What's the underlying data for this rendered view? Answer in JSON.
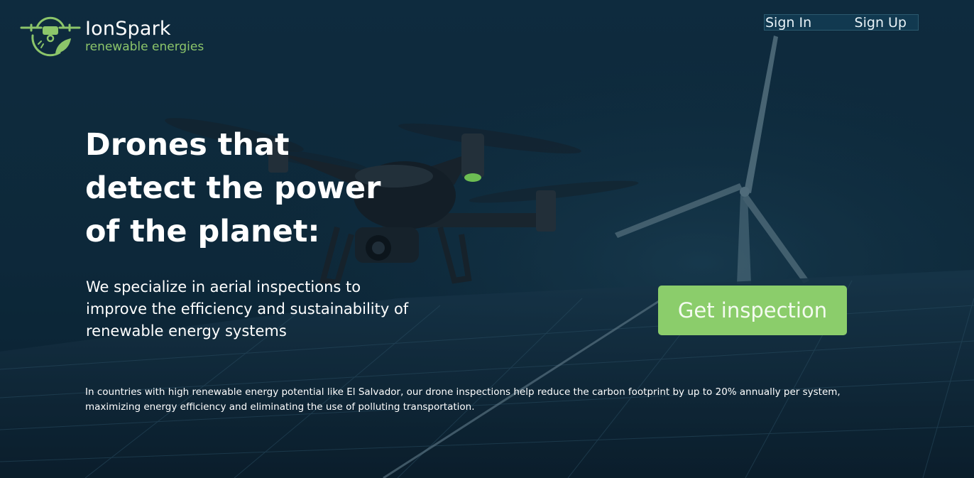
{
  "brand": {
    "name": "IonSpark",
    "tagline": "renewable energies",
    "accent_color": "#8cc56a",
    "logo_icon": "drone-leaf-icon"
  },
  "nav": {
    "sign_in": "Sign In",
    "sign_up": "Sign Up"
  },
  "hero": {
    "headline": "Drones that detect the power of the planet:",
    "subheadline": "We specialize in aerial inspections to improve the efficiency and sustainability of renewable energy systems",
    "cta_label": "Get inspection",
    "cta_color": "#8bcd6b",
    "footnote": "In countries with high renewable energy potential like El Salvador, our drone inspections help reduce the carbon footprint by up to 20% annually per system, maximizing energy efficiency and eliminating the use of polluting transportation."
  },
  "background": {
    "imagery": [
      "drone-icon",
      "wind-turbine-icon",
      "solar-panels-icon"
    ]
  }
}
